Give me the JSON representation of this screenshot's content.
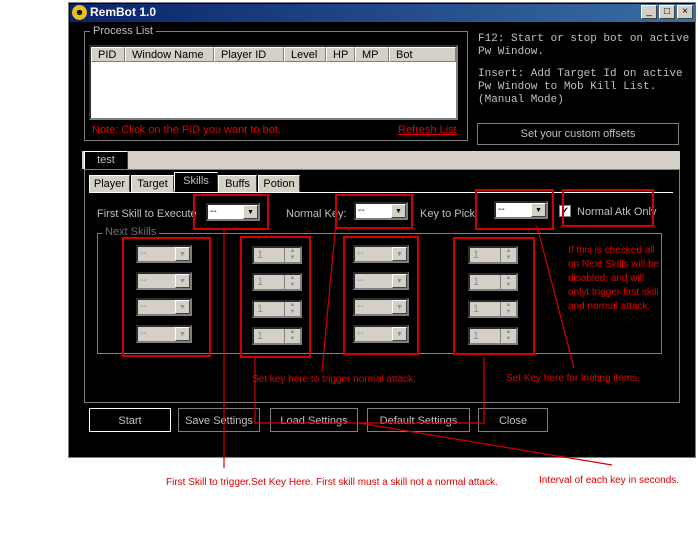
{
  "window": {
    "title": "RemBot 1.0",
    "minimize": "_",
    "maximize": "□",
    "close": "×"
  },
  "process_list": {
    "title": "Process List",
    "columns": [
      "PID",
      "Window Name",
      "Player ID",
      "Level",
      "HP",
      "MP",
      "Bot"
    ],
    "note": "Note: Click on the PID you want to bot.",
    "refresh": "Refresh List"
  },
  "info": {
    "line1": "F12: Start or stop bot on active",
    "line2": "Pw Window.",
    "line3": "Insert: Add Target Id on active",
    "line4": "Pw Window to Mob Kill List.",
    "line5": "(Manual Mode)",
    "offsets_button": "Set your custom offsets"
  },
  "profile_tab": "test",
  "tabs": [
    "Player",
    "Target",
    "Skills",
    "Buffs",
    "Potion"
  ],
  "active_tab": "Skills",
  "skills": {
    "first_skill_label": "First Skill to Execute",
    "first_skill_value": "--",
    "normal_key_label": "Normal Key:",
    "normal_key_value": "--",
    "key_to_pick_label": "Key to Pick",
    "key_to_pick_value": "--",
    "normal_atk_only_label": "Normal Atk Only",
    "normal_atk_only_checked": true,
    "next_skills_label": "Next Skills",
    "skill_placeholder": "--",
    "interval_value": "1"
  },
  "buttons": {
    "start": "Start",
    "save": "Save Settings",
    "load": "Load Settings",
    "default": "Default Settings",
    "close": "Close"
  },
  "annotations": {
    "checkbox_note_1": "If this is checked all",
    "checkbox_note_2": "on Next Skills will be",
    "checkbox_note_3": "disabled, and will",
    "checkbox_note_4": "onlyt trigger first skill",
    "checkbox_note_5": "and normal attack.",
    "normal_key_note": "Set key here to trigger normal attack.",
    "loot_note": "Set Key here for looting items.",
    "first_skill_note": "First Skill to trigger.Set Key Here. First skill must a skill not a normal attack.",
    "interval_note": "Interval of each key in seconds."
  },
  "colors": {
    "annotation": "#e00000",
    "background": "#000000",
    "titlebar": "#0a246a"
  }
}
